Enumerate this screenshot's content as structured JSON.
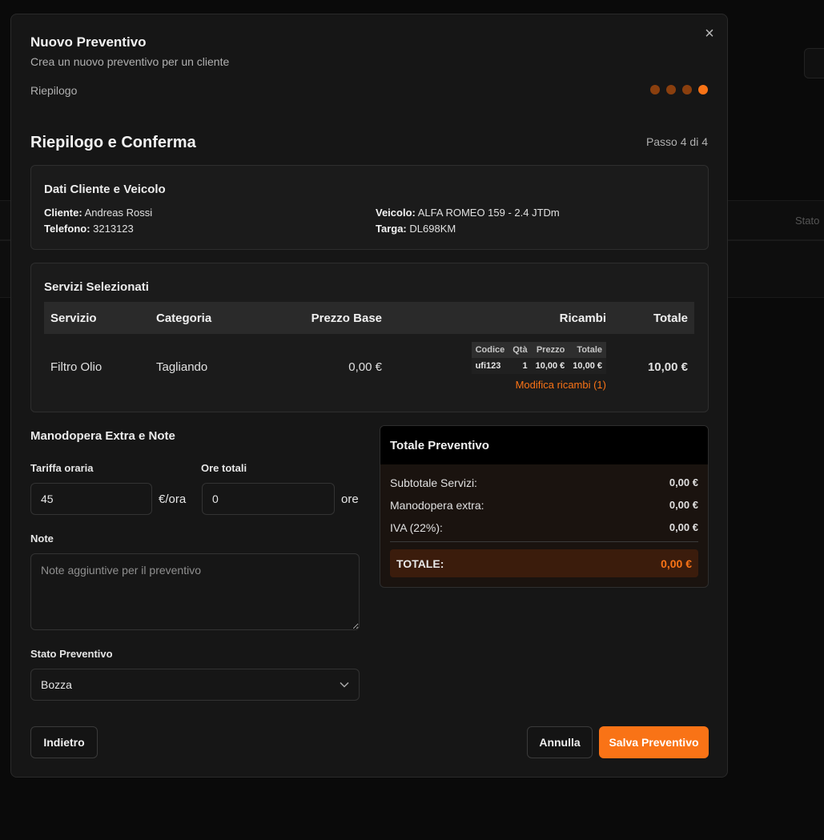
{
  "modal": {
    "title": "Nuovo Preventivo",
    "subtitle": "Crea un nuovo preventivo per un cliente",
    "current_step_label": "Riepilogo",
    "close_glyph": "×"
  },
  "step": {
    "heading": "Riepilogo e Conferma",
    "counter": "Passo 4 di 4",
    "total": 4,
    "current": 4
  },
  "customer_card": {
    "title": "Dati Cliente e Veicolo",
    "cliente_label": "Cliente:",
    "cliente_value": "Andreas Rossi",
    "telefono_label": "Telefono:",
    "telefono_value": "3213123",
    "veicolo_label": "Veicolo:",
    "veicolo_value": "ALFA ROMEO 159 - 2.4 JTDm",
    "targa_label": "Targa:",
    "targa_value": "DL698KM"
  },
  "services": {
    "title": "Servizi Selezionati",
    "headers": [
      "Servizio",
      "Categoria",
      "Prezzo Base",
      "Ricambi",
      "Totale"
    ],
    "rows": [
      {
        "servizio": "Filtro Olio",
        "categoria": "Tagliando",
        "prezzo_base": "0,00 €",
        "totale": "10,00 €",
        "parts_headers": [
          "Codice",
          "Qtà",
          "Prezzo",
          "Totale"
        ],
        "parts": [
          {
            "codice": "ufi123",
            "qta": "1",
            "prezzo": "10,00 €",
            "totale": "10,00 €"
          }
        ],
        "modify_link": "Modifica ricambi (1)"
      }
    ]
  },
  "extra": {
    "title": "Manodopera Extra e Note",
    "rate_label": "Tariffa oraria",
    "rate_value": "45",
    "rate_unit": "€/ora",
    "hours_label": "Ore totali",
    "hours_value": "0",
    "hours_unit": "ore",
    "notes_label": "Note",
    "notes_placeholder": "Note aggiuntive per il preventivo",
    "status_label": "Stato Preventivo",
    "status_value": "Bozza"
  },
  "totals": {
    "title": "Totale Preventivo",
    "rows": [
      {
        "label": "Subtotale Servizi:",
        "value": "0,00 €"
      },
      {
        "label": "Manodopera extra:",
        "value": "0,00 €"
      },
      {
        "label": "IVA (22%):",
        "value": "0,00 €"
      }
    ],
    "total_label": "TOTALE:",
    "total_value": "0,00 €"
  },
  "buttons": {
    "back": "Indietro",
    "cancel": "Annulla",
    "save": "Salva Preventivo"
  },
  "colors": {
    "accent": "#f97316",
    "dot_inactive": "#8a3f0e"
  }
}
